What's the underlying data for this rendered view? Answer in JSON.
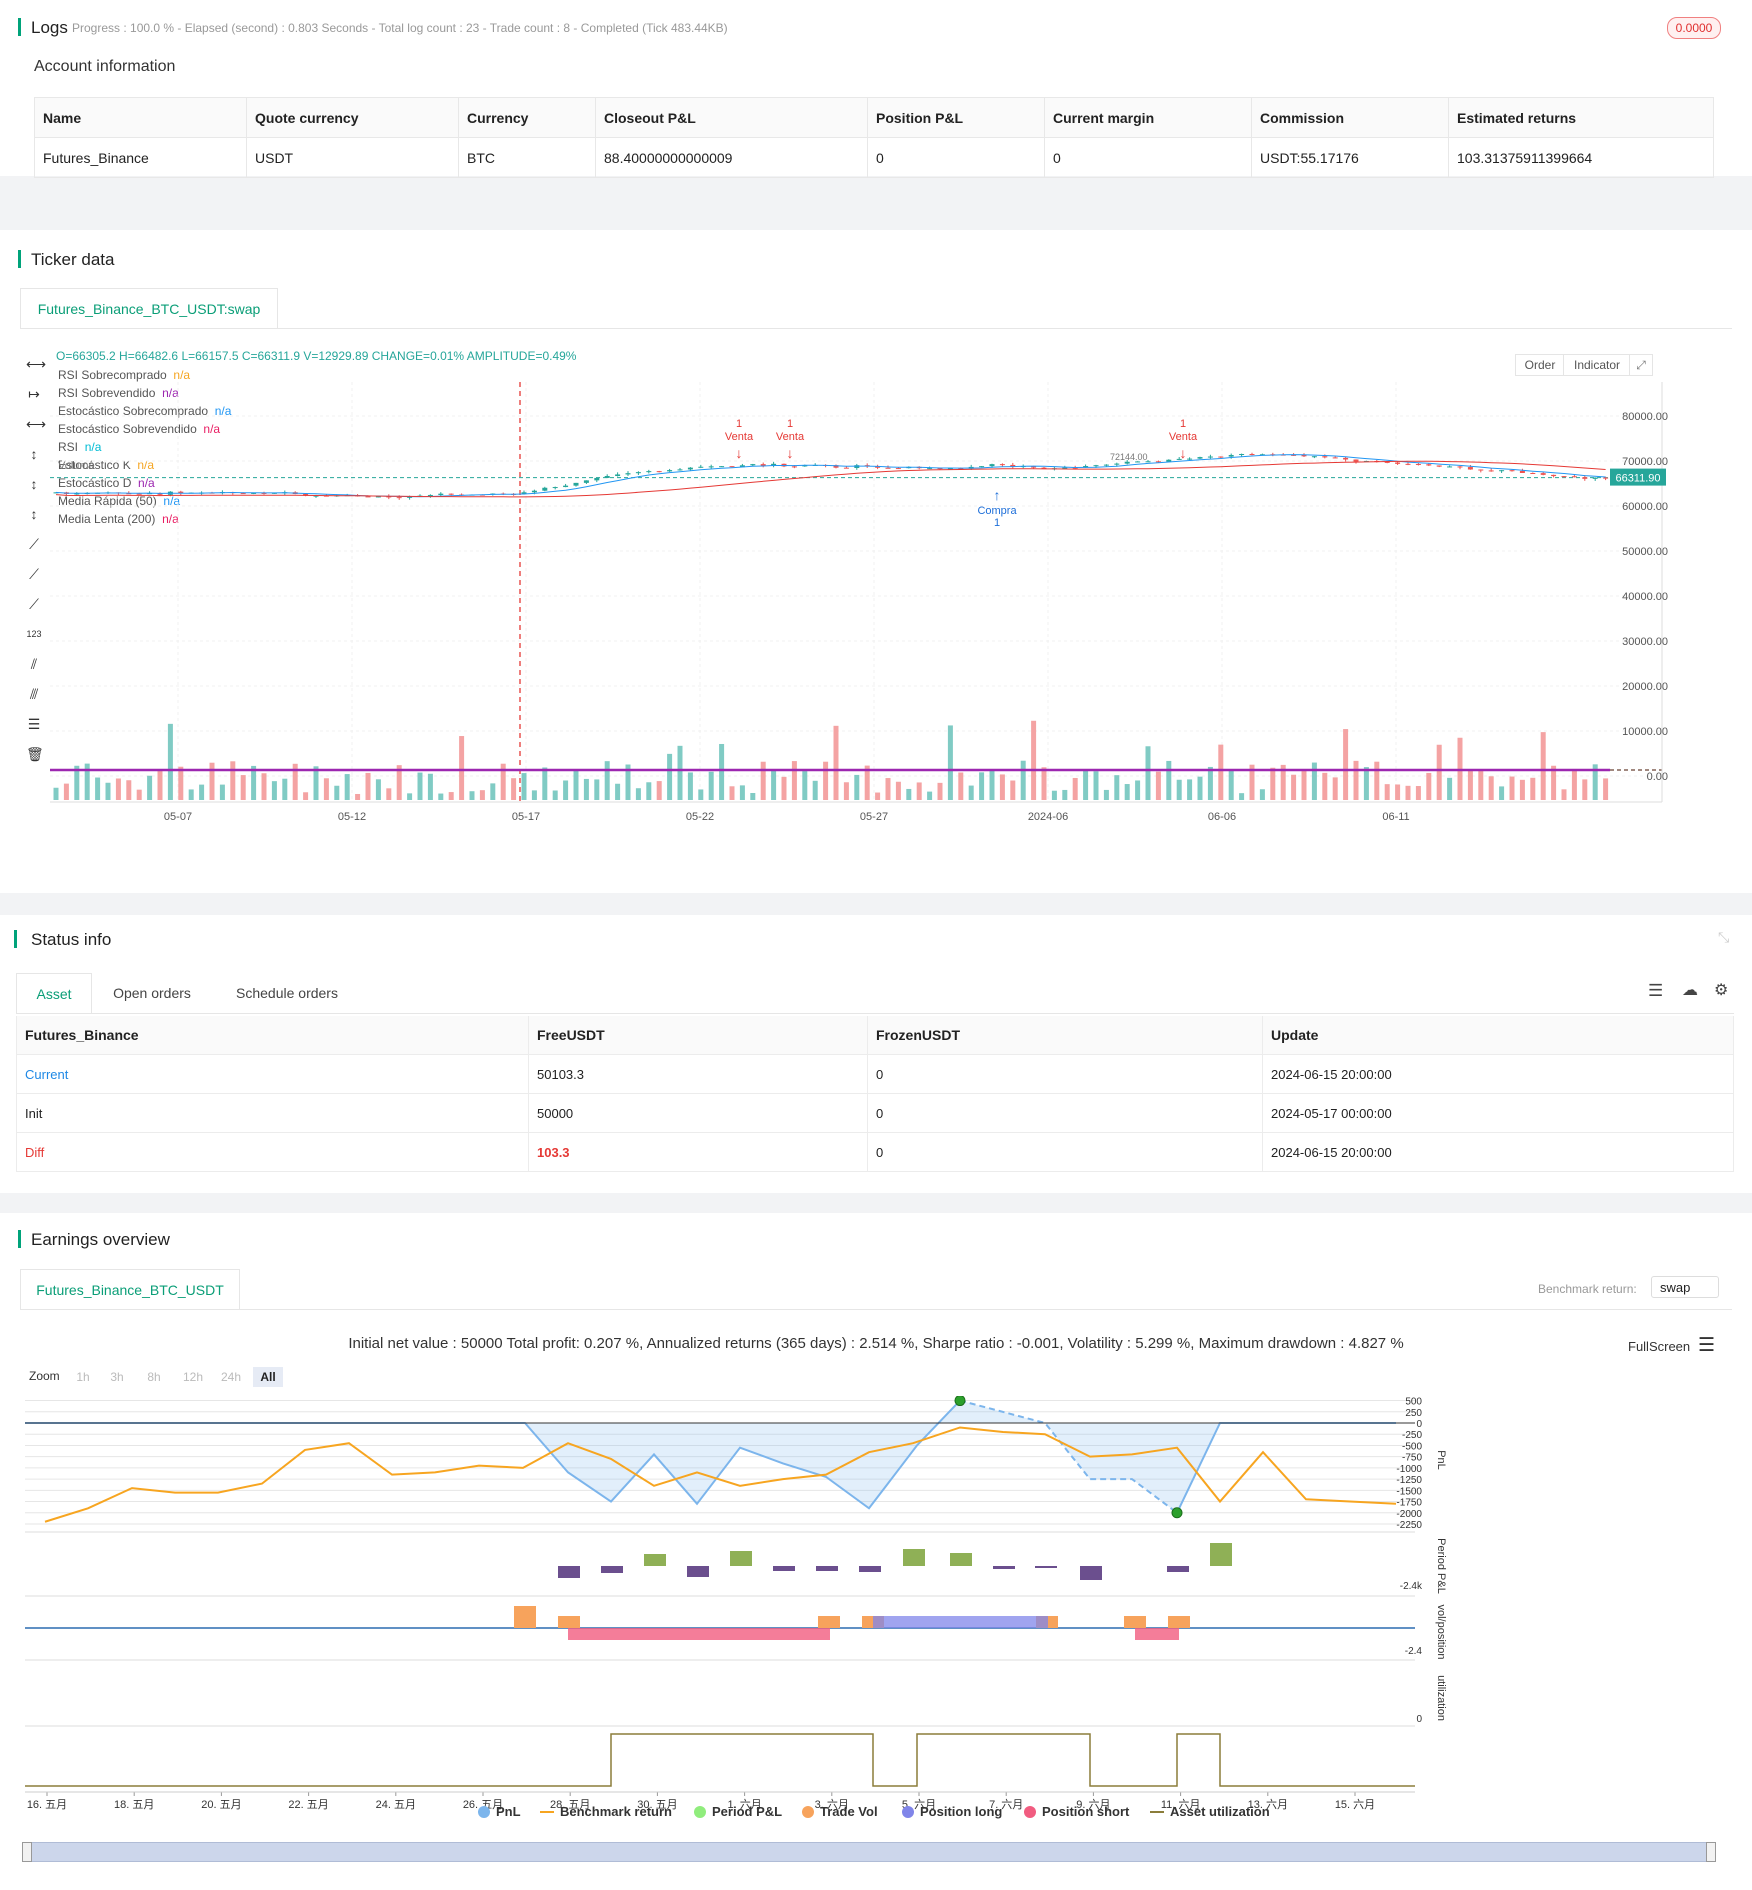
{
  "logs": {
    "title": "Logs",
    "progress": "Progress : 100.0 % - Elapsed (second) : 0.803  Seconds - Total log count : 23 - Trade count : 8 - Completed (Tick 483.44KB)",
    "badge": "0.0000"
  },
  "account": {
    "title": "Account information",
    "headers": [
      "Name",
      "Quote currency",
      "Currency",
      "Closeout P&L",
      "Position P&L",
      "Current margin",
      "Commission",
      "Estimated returns"
    ],
    "row": [
      "Futures_Binance",
      "USDT",
      "BTC",
      "88.40000000000009",
      "0",
      "0",
      "USDT:55.17176",
      "103.31375911399664"
    ]
  },
  "ticker": {
    "title": "Ticker data",
    "tab": "Futures_Binance_BTC_USDT:swap",
    "ohlc": "O=66305.2 H=66482.6 L=66157.5 C=66311.9 V=12929.89 CHANGE=0.01% AMPLITUDE=0.49%",
    "order_btn": "Order",
    "indicator_btn": "Indicator",
    "indicators": [
      {
        "name": "RSI Sobrecomprado",
        "value": "n/a",
        "color": "#f5a623"
      },
      {
        "name": "RSI Sobrevendido",
        "value": "n/a",
        "color": "#9c27b0"
      },
      {
        "name": "Estocástico Sobrecomprado",
        "value": "n/a",
        "color": "#2196f3"
      },
      {
        "name": "Estocástico Sobrevendido",
        "value": "n/a",
        "color": "#e91e63"
      },
      {
        "name": "RSI",
        "value": "n/a",
        "color": "#00bcd4"
      },
      {
        "name": "Estocástico K",
        "value": "n/a",
        "color": "#f5a623"
      },
      {
        "name": "Estocástico D",
        "value": "n/a",
        "color": "#9c27b0"
      },
      {
        "name": "Media Rápida (50)",
        "value": "n/a",
        "color": "#2196f3"
      },
      {
        "name": "Media Lenta (200)",
        "value": "n/a",
        "color": "#e91e63"
      }
    ],
    "overlay_label": "Volume",
    "y_ticks": [
      "80000.00",
      "70000.00",
      "60000.00",
      "50000.00",
      "40000.00",
      "30000.00",
      "20000.00",
      "10000.00",
      "0.00"
    ],
    "x_ticks": [
      "05-07",
      "05-12",
      "05-17",
      "05-22",
      "05-27",
      "2024-06",
      "06-06",
      "06-11"
    ],
    "price_label": "66311.90",
    "high_label": "72144.00",
    "signals": [
      {
        "type": "sell",
        "label": "Venta",
        "qty": "1"
      },
      {
        "type": "sell",
        "label": "Venta",
        "qty": "1"
      },
      {
        "type": "sell",
        "label": "Venta",
        "qty": "1"
      },
      {
        "type": "buy",
        "label": "Compra",
        "qty": "1"
      }
    ]
  },
  "status": {
    "title": "Status info",
    "tabs": [
      "Asset",
      "Open orders",
      "Schedule orders"
    ],
    "headers": [
      "Futures_Binance",
      "FreeUSDT",
      "FrozenUSDT",
      "Update"
    ],
    "rows": [
      {
        "name": "Current",
        "free": "50103.3",
        "frozen": "0",
        "update": "2024-06-15 20:00:00"
      },
      {
        "name": "Init",
        "free": "50000",
        "frozen": "0",
        "update": "2024-05-17 00:00:00"
      },
      {
        "name": "Diff",
        "free": "103.3",
        "frozen": "0",
        "update": "2024-06-15 20:00:00"
      }
    ]
  },
  "earnings": {
    "title": "Earnings overview",
    "tab": "Futures_Binance_BTC_USDT",
    "benchmark_label": "Benchmark return:",
    "benchmark_value": "swap",
    "summary": "Initial net value : 50000 Total profit: 0.207 %, Annualized returns (365 days) : 2.514 %, Sharpe ratio : -0.001, Volatility : 5.299 %, Maximum drawdown : 4.827 %",
    "fullscreen": "FullScreen",
    "zoom_label": "Zoom",
    "zoom_options": [
      "1h",
      "3h",
      "8h",
      "12h",
      "24h",
      "All"
    ],
    "pnl_ticks": [
      "500",
      "250",
      "0",
      "-250",
      "-500",
      "-750",
      "-1000",
      "-1250",
      "-1500",
      "-1750",
      "-2000",
      "-2250"
    ],
    "axis_titles": [
      "PnL",
      "Period P&L",
      "vol/position",
      "utilization"
    ],
    "period_tick": "-2.4k",
    "vol_tick": "-2.4",
    "util_tick": "0",
    "x_ticks": [
      "16. 五月",
      "18. 五月",
      "20. 五月",
      "22. 五月",
      "24. 五月",
      "26. 五月",
      "28. 五月",
      "30. 五月",
      "1. 六月",
      "3. 六月",
      "5. 六月",
      "7. 六月",
      "9. 六月",
      "11. 六月",
      "13. 六月",
      "15. 六月"
    ],
    "legend": [
      {
        "name": "PnL",
        "color": "#7cb5ec"
      },
      {
        "name": "Benchmark return",
        "color": "#f7a520"
      },
      {
        "name": "Period P&L",
        "color": "#90ed7d"
      },
      {
        "name": "Trade Vol",
        "color": "#f7a35c"
      },
      {
        "name": "Position long",
        "color": "#8085e9"
      },
      {
        "name": "Position short",
        "color": "#f15c80"
      },
      {
        "name": "Asset utilization",
        "color": "#8b7d3a"
      }
    ]
  }
}
